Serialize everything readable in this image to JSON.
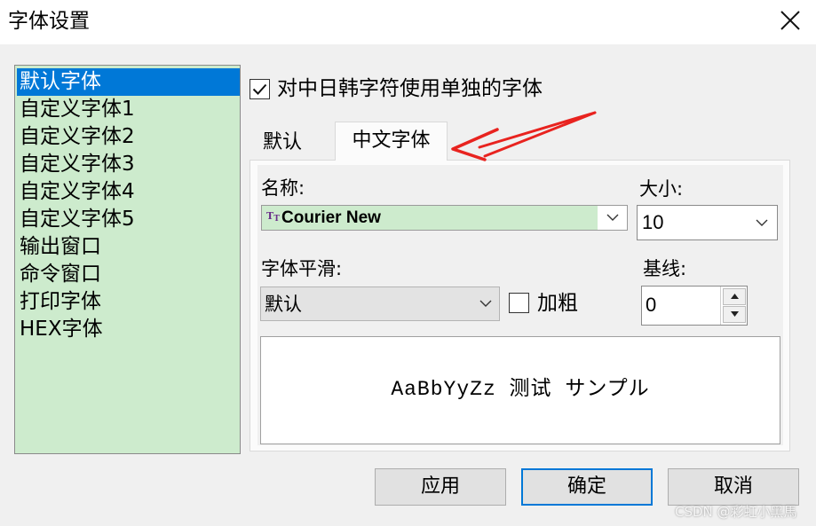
{
  "window": {
    "title": "字体设置",
    "close_icon": "close-icon"
  },
  "font_list": {
    "items": [
      {
        "label": "默认字体",
        "selected": true
      },
      {
        "label": "自定义字体1",
        "selected": false
      },
      {
        "label": "自定义字体2",
        "selected": false
      },
      {
        "label": "自定义字体3",
        "selected": false
      },
      {
        "label": "自定义字体4",
        "selected": false
      },
      {
        "label": "自定义字体5",
        "selected": false
      },
      {
        "label": "输出窗口",
        "selected": false
      },
      {
        "label": "命令窗口",
        "selected": false
      },
      {
        "label": "打印字体",
        "selected": false
      },
      {
        "label": "HEX字体",
        "selected": false
      }
    ],
    "background": "#cdebcd",
    "selected_color": "#0078d7"
  },
  "cjk_option": {
    "label": "对中日韩字符使用单独的字体",
    "checked": true
  },
  "tabs": [
    {
      "label": "默认",
      "active": false
    },
    {
      "label": "中文字体",
      "active": true
    }
  ],
  "font_name": {
    "label": "名称:",
    "value": "Courier New",
    "icon": "truetype-font-icon"
  },
  "font_size": {
    "label": "大小:",
    "value": "10"
  },
  "smoothing": {
    "label": "字体平滑:",
    "value": "默认"
  },
  "bold": {
    "label": "加粗",
    "checked": false
  },
  "baseline": {
    "label": "基线:",
    "value": "0"
  },
  "preview": {
    "text": "AaBbYyZz 测试 サンプル"
  },
  "buttons": {
    "apply": "应用",
    "ok": "确定",
    "cancel": "取消"
  },
  "annotation": {
    "color": "#e8231f"
  },
  "watermark": "CSDN @彩虹小黑馬"
}
